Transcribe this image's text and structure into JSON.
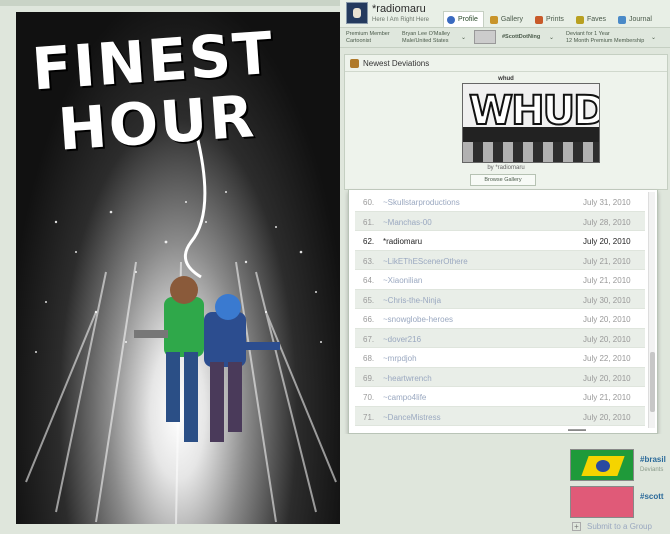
{
  "artwork": {
    "title_line1": "FINEST",
    "title_line2": "HOUR"
  },
  "profile": {
    "username": "*radiomaru",
    "tagline": "Here I Am Right Here",
    "tabs": [
      {
        "label": "Profile",
        "icon": "profile-icon",
        "active": true
      },
      {
        "label": "Gallery",
        "icon": "gallery-icon",
        "active": false
      },
      {
        "label": "Prints",
        "icon": "prints-icon",
        "active": false
      },
      {
        "label": "Faves",
        "icon": "faves-icon",
        "active": false
      },
      {
        "label": "Journal",
        "icon": "journal-icon",
        "active": false
      }
    ],
    "info": {
      "member_type": "Premium Member",
      "member_role": "Cartoonist",
      "real_name": "Bryan Lee O'Malley",
      "location": "Male/United States",
      "badge": "#ScottDotNing",
      "deviant_for": "Deviant for 1 Year",
      "membership": "12 Month Premium Membership"
    }
  },
  "newest_deviations": {
    "heading": "Newest Deviations",
    "thumb_title": "whud",
    "thumb_word": "WHUD",
    "thumb_by": "by *radiomaru",
    "browse_label": "Browse Gallery"
  },
  "watchers": [
    {
      "num": "60.",
      "who": "~Skullstarproductions",
      "date": "July 31, 2010",
      "highlight": false
    },
    {
      "num": "61.",
      "who": "~Manchas-00",
      "date": "July 28, 2010",
      "highlight": false
    },
    {
      "num": "62.",
      "who": "*radiomaru",
      "date": "July 20, 2010",
      "highlight": true
    },
    {
      "num": "63.",
      "who": "~LikEThEScenerOthere",
      "date": "July 21, 2010",
      "highlight": false
    },
    {
      "num": "64.",
      "who": "~Xiaonilian",
      "date": "July 21, 2010",
      "highlight": false
    },
    {
      "num": "65.",
      "who": "~Chris-the-Ninja",
      "date": "July 30, 2010",
      "highlight": false
    },
    {
      "num": "66.",
      "who": "~snowglobe-heroes",
      "date": "July 20, 2010",
      "highlight": false
    },
    {
      "num": "67.",
      "who": "~dover216",
      "date": "July 20, 2010",
      "highlight": false
    },
    {
      "num": "68.",
      "who": "~mrpdjoh",
      "date": "July 22, 2010",
      "highlight": false
    },
    {
      "num": "69.",
      "who": "~heartwrench",
      "date": "July 20, 2010",
      "highlight": false
    },
    {
      "num": "70.",
      "who": "~campo4life",
      "date": "July 21, 2010",
      "highlight": false
    },
    {
      "num": "71.",
      "who": "~DanceMistress",
      "date": "July 20, 2010",
      "highlight": false
    }
  ],
  "groups": [
    {
      "name": "#brasil",
      "sub": "Deviants"
    },
    {
      "name": "#scott",
      "sub": ""
    }
  ],
  "submit_label": "Submit to a Group",
  "colors": {
    "page_bg": "#dfe6dc",
    "link": "#2b6a9a",
    "active_tab": "#ffffff"
  }
}
